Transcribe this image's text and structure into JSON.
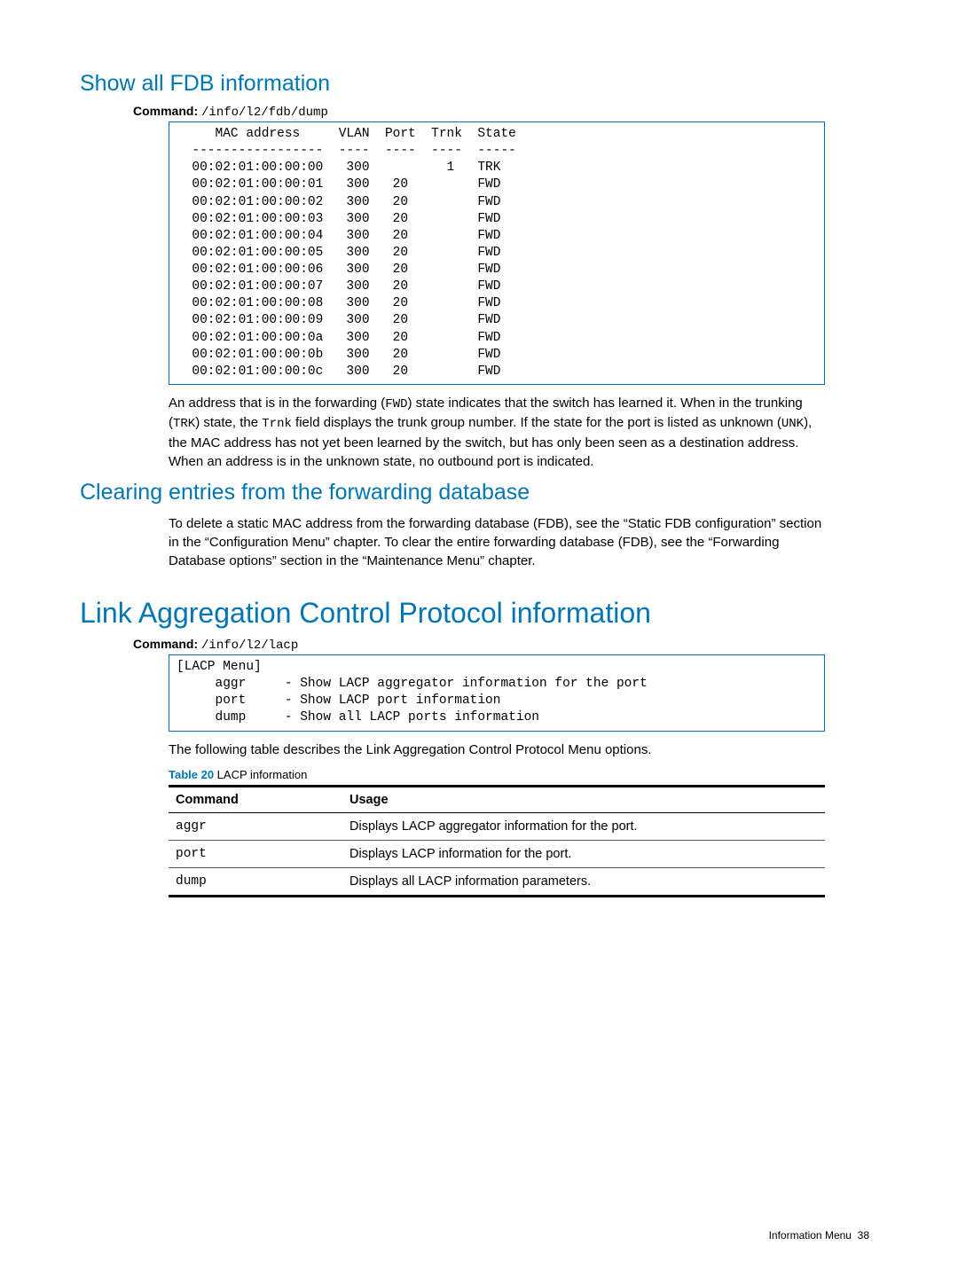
{
  "section1": {
    "heading": "Show all FDB information",
    "command_label": "Command:",
    "command_text": "/info/l2/fdb/dump",
    "fdb_header": "     MAC address     VLAN  Port  Trnk  State",
    "fdb_divider": "  -----------------  ----  ----  ----  -----",
    "fdb_rows": [
      "  00:02:01:00:00:00   300          1   TRK",
      "  00:02:01:00:00:01   300   20         FWD",
      "  00:02:01:00:00:02   300   20         FWD",
      "  00:02:01:00:00:03   300   20         FWD",
      "  00:02:01:00:00:04   300   20         FWD",
      "  00:02:01:00:00:05   300   20         FWD",
      "  00:02:01:00:00:06   300   20         FWD",
      "  00:02:01:00:00:07   300   20         FWD",
      "  00:02:01:00:00:08   300   20         FWD",
      "  00:02:01:00:00:09   300   20         FWD",
      "  00:02:01:00:00:0a   300   20         FWD",
      "  00:02:01:00:00:0b   300   20         FWD",
      "  00:02:01:00:00:0c   300   20         FWD"
    ],
    "para_parts": [
      "An address that is in the forwarding (",
      "FWD",
      ") state indicates that the switch has learned it. When in the trunking (",
      "TRK",
      ") state, the ",
      "Trnk",
      " field displays the trunk group number. If the state for the port is listed as unknown (",
      "UNK",
      "), the MAC address has not yet been learned by the switch, but has only been seen as a destination address. When an address is in the unknown state, no outbound port is indicated."
    ]
  },
  "section2": {
    "heading": "Clearing entries from the forwarding database",
    "para": "To delete a static MAC address from the forwarding database (FDB), see the “Static FDB configuration” section in the “Configuration Menu” chapter. To clear the entire forwarding database (FDB), see the “Forwarding Database options” section in the “Maintenance Menu” chapter."
  },
  "section3": {
    "heading": "Link Aggregation Control Protocol information",
    "command_label": "Command:",
    "command_text": "/info/l2/lacp",
    "menu_lines": [
      "[LACP Menu]",
      "     aggr     - Show LACP aggregator information for the port",
      "     port     - Show LACP port information",
      "     dump     - Show all LACP ports information"
    ],
    "para": "The following table describes the Link Aggregation Control Protocol Menu options.",
    "table_caption_label": "Table 20",
    "table_caption_text": "  LACP information",
    "table_headers": {
      "c1": "Command",
      "c2": "Usage"
    },
    "table_rows": [
      {
        "c1": "aggr",
        "c2": "Displays LACP aggregator information for the port."
      },
      {
        "c1": "port",
        "c2": "Displays LACP information for the port."
      },
      {
        "c1": "dump",
        "c2": "Displays all LACP information parameters."
      }
    ]
  },
  "footer": {
    "section": "Information Menu",
    "page": "38"
  }
}
